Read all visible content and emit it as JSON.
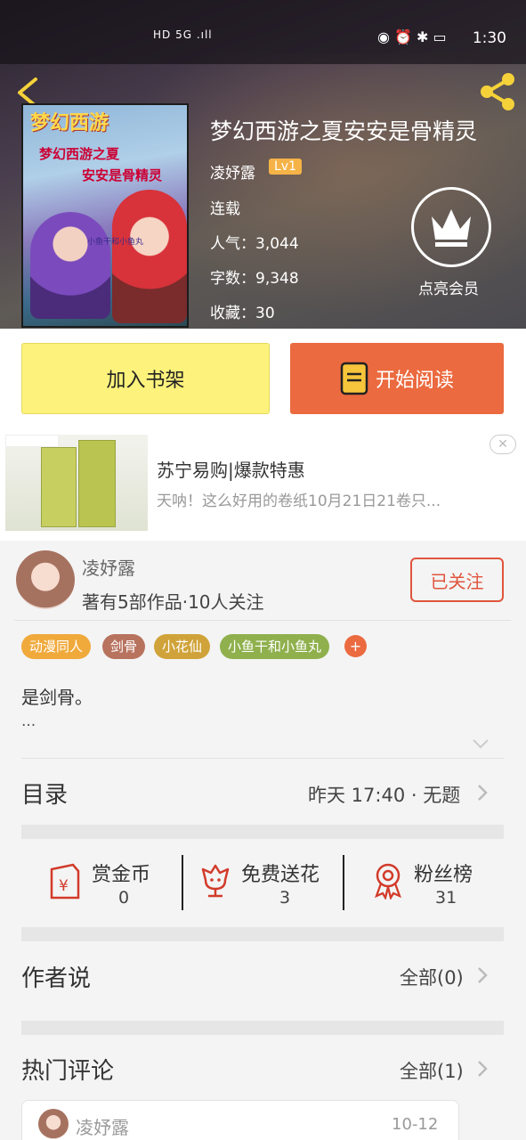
{
  "status_bar": {
    "left": "HD 5G .ıll",
    "time": "1:30"
  },
  "book": {
    "title": "梦幻西游之夏安安是骨精灵",
    "author": "凌妤露",
    "level": "Lv1",
    "status": "连载",
    "stats": [
      {
        "label": "人气：",
        "value": "3,044"
      },
      {
        "label": "字数：",
        "value": "9,348"
      },
      {
        "label": "收藏：",
        "value": "30"
      }
    ],
    "cover": {
      "logo": "梦幻西游",
      "line1": "梦幻西游之夏",
      "line2": "安安是骨精灵",
      "footer": "小鱼干和小鱼丸"
    },
    "vip_label": "点亮会员"
  },
  "actions": {
    "shelf": "加入书架",
    "read": "开始阅读"
  },
  "ad": {
    "title": "苏宁易购|爆款特惠",
    "subtitle": "天呐！这么好用的卷纸10月21日21卷只..."
  },
  "author_card": {
    "name": "凌妤露",
    "meta": "著有5部作品·10人关注",
    "follow": "已关注"
  },
  "tags": [
    {
      "label": "动漫同人",
      "color": "#f0a93b"
    },
    {
      "label": "剑骨",
      "color": "#b8735f"
    },
    {
      "label": "小花仙",
      "color": "#d0a33a"
    },
    {
      "label": "小鱼干和小鱼丸",
      "color": "#8fb04d"
    }
  ],
  "tag_more": "+",
  "description": "是剑骨。",
  "description_more": "...",
  "toc": {
    "title": "目录",
    "latest": "昨天 17:40 · 无题"
  },
  "rewards": [
    {
      "label": "赏金币",
      "count": "0"
    },
    {
      "label": "免费送花",
      "count": "3"
    },
    {
      "label": "粉丝榜",
      "count": "31"
    }
  ],
  "author_says": {
    "title": "作者说",
    "link": "全部(0)"
  },
  "hot_comments": {
    "title": "热门评论",
    "link": "全部(1)"
  },
  "comment": {
    "user": "凌妤露",
    "date": "10-12"
  },
  "colors": {
    "accent": "#eb6a3f",
    "shelf": "#fdf27c",
    "icon_red": "#d23b2a"
  }
}
